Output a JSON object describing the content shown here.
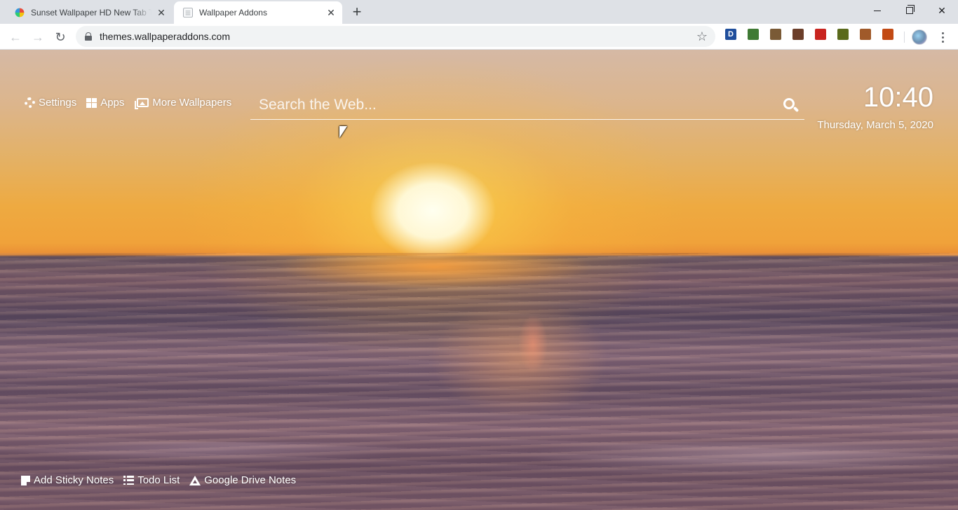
{
  "browser": {
    "tabs": [
      {
        "title": "Sunset Wallpaper HD New Tab Theme",
        "active": false
      },
      {
        "title": "Wallpaper Addons",
        "active": true
      }
    ],
    "new_tab_label": "+",
    "close_glyph": "✕",
    "address": {
      "url": "themes.wallpaperaddons.com"
    },
    "window_controls": {
      "close_glyph": "✕"
    },
    "extensions": [
      {
        "icon": "dashlane-extension-icon",
        "letter": "D",
        "color": "#1f4e9c"
      },
      {
        "icon": "theme-extension-icon-1",
        "color": "#3f7a34"
      },
      {
        "icon": "theme-extension-icon-2",
        "color": "#7a5a36"
      },
      {
        "icon": "theme-extension-icon-3",
        "color": "#6b3e2a"
      },
      {
        "icon": "theme-extension-icon-4",
        "color": "#c8241f"
      },
      {
        "icon": "theme-extension-icon-5",
        "color": "#5a6a1c"
      },
      {
        "icon": "theme-extension-icon-6",
        "color": "#a05a2a"
      },
      {
        "icon": "theme-extension-icon-7",
        "color": "#c24a14"
      }
    ]
  },
  "page": {
    "top_links": {
      "settings": "Settings",
      "apps": "Apps",
      "more_wallpapers": "More Wallpapers"
    },
    "search": {
      "placeholder": "Search the Web..."
    },
    "clock": {
      "time": "10:40",
      "date": "Thursday, March 5, 2020"
    },
    "bottom_links": {
      "sticky_notes": "Add Sticky Notes",
      "todo": "Todo List",
      "drive_notes": "Google Drive Notes"
    }
  }
}
